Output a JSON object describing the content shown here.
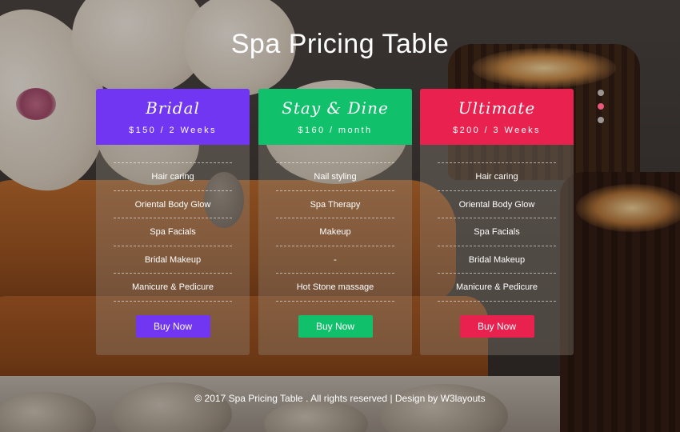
{
  "page": {
    "title": "Spa Pricing Table"
  },
  "slider": {
    "dots": 3,
    "active_index": 1
  },
  "plans": [
    {
      "name": "Bridal",
      "price": "$150 / 2 Weeks",
      "color": "#7136f2",
      "features": [
        "Hair caring",
        "Oriental Body Glow",
        "Spa Facials",
        "Bridal Makeup",
        "Manicure & Pedicure"
      ],
      "button_label": "Buy Now"
    },
    {
      "name": "Stay & Dine",
      "price": "$160 / month",
      "color": "#10c06a",
      "features": [
        "Nail styling",
        "Spa Therapy",
        "Makeup",
        "-",
        "Hot Stone massage"
      ],
      "button_label": "Buy Now"
    },
    {
      "name": "Ultimate",
      "price": "$200 / 3 Weeks",
      "color": "#e8214f",
      "features": [
        "Hair caring",
        "Oriental Body Glow",
        "Spa Facials",
        "Bridal Makeup",
        "Manicure & Pedicure"
      ],
      "button_label": "Buy Now"
    }
  ],
  "footer": {
    "text": "© 2017 Spa Pricing Table . All rights reserved | Design by W3layouts"
  }
}
